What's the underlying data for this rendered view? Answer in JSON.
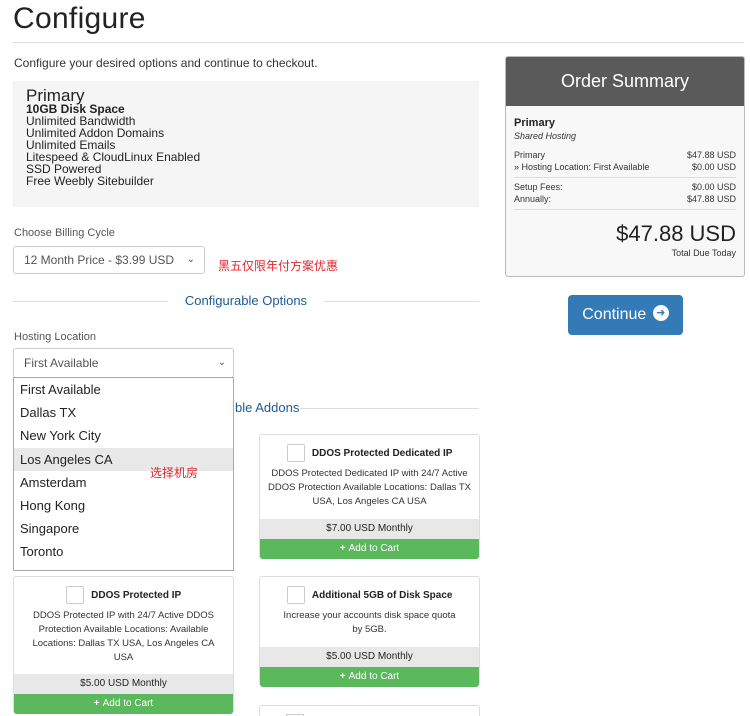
{
  "page": {
    "title": "Configure",
    "intro": "Configure your desired options and continue to checkout."
  },
  "product": {
    "name": "Primary",
    "features": [
      "10GB Disk Space",
      "Unlimited Bandwidth",
      "Unlimited Addon Domains",
      "Unlimited Emails",
      "Litespeed & CloudLinux Enabled",
      "SSD Powered",
      "Free Weebly Sitebuilder"
    ]
  },
  "billing": {
    "label": "Choose Billing Cycle",
    "selected": "12 Month Price - $3.99 USD",
    "promo_note": "黑五仅限年付方案优惠"
  },
  "configurable_options": {
    "heading": "Configurable Options",
    "hosting_location": {
      "label": "Hosting Location",
      "selected": "First Available",
      "options": [
        "First Available",
        "Dallas TX",
        "New York City",
        "Los Angeles CA",
        "Amsterdam",
        "Hong Kong",
        "Singapore",
        "Toronto"
      ],
      "highlighted": "Los Angeles CA",
      "annotation": "选择机房"
    }
  },
  "addons": {
    "heading_visible": "ble Addons",
    "items": [
      {
        "name": "DDOS Protected Dedicated IP",
        "description": "DDOS Protected Dedicated IP with 24/7 Active DDOS Protection Available Locations: Dallas TX USA, Los Angeles CA USA",
        "price": "$7.00 USD Monthly",
        "cart_label": "Add to Cart"
      },
      {
        "name": "DDOS Protected IP",
        "description": "DDOS Protected IP with 24/7 Active DDOS Protection Available Locations: Available Locations: Dallas TX USA, Los Angeles CA USA",
        "price": "$5.00 USD Monthly",
        "cart_label": "Add to Cart"
      },
      {
        "name": "Additional 5GB of Disk Space",
        "description": "Increase your accounts disk space quota by 5GB.",
        "price": "$5.00 USD Monthly",
        "cart_label": "Add to Cart"
      }
    ]
  },
  "summary": {
    "heading": "Order Summary",
    "product": "Primary",
    "group": "Shared Hosting",
    "lines": [
      {
        "label": "Primary",
        "value": "$47.88 USD"
      },
      {
        "label": "» Hosting Location: First Available",
        "value": "$0.00 USD"
      }
    ],
    "fees": [
      {
        "label": "Setup Fees:",
        "value": "$0.00 USD"
      },
      {
        "label": "Annually:",
        "value": "$47.88 USD"
      }
    ],
    "total": "$47.88 USD",
    "total_label": "Total Due Today"
  },
  "continue_button": {
    "label": "Continue"
  },
  "colors": {
    "heading_blue": "#1f5a96",
    "button_blue": "#337ab7",
    "cart_green": "#5cb85c",
    "promo_red": "#e3262e",
    "summary_header": "#5a5a5a"
  }
}
